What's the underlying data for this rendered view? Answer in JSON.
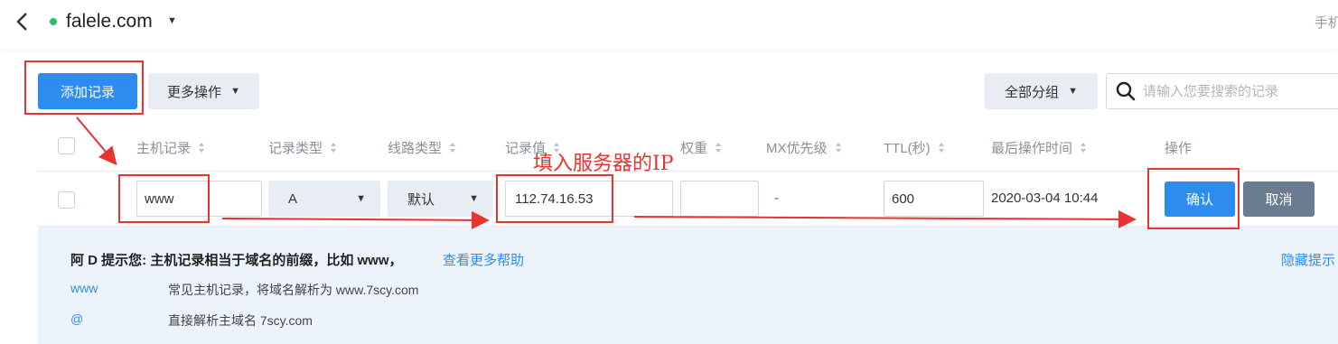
{
  "header": {
    "domain": "falele.com",
    "right_text": "手机"
  },
  "toolbar": {
    "add_label": "添加记录",
    "more_label": "更多操作",
    "group_label": "全部分组",
    "search_placeholder": "请输入您要搜索的记录"
  },
  "table": {
    "columns": [
      "主机记录",
      "记录类型",
      "线路类型",
      "记录值",
      "权重",
      "MX优先级",
      "TTL(秒)",
      "最后操作时间",
      "操作"
    ]
  },
  "edit_row": {
    "host": "www",
    "type": "A",
    "line": "默认",
    "value": "112.74.16.53",
    "weight": "",
    "mx": "-",
    "ttl": "600",
    "last_modified": "2020-03-04 10:44",
    "confirm_label": "确认",
    "cancel_label": "取消"
  },
  "help": {
    "title": "阿 D 提示您: 主机记录相当于域名的前缀，比如 www，",
    "more_link": "查看更多帮助",
    "hide_link": "隐藏提示",
    "items": [
      {
        "key": "www",
        "desc": "常见主机记录，将域名解析为 www.7scy.com"
      },
      {
        "key": "@",
        "desc": "直接解析主域名 7scy.com"
      }
    ]
  },
  "annotation": {
    "text": "填入服务器的IP",
    "color": "#e8332e"
  },
  "colors": {
    "primary": "#2d8cf0",
    "cancel": "#6b7b90",
    "status_online": "#2dbd6e"
  }
}
